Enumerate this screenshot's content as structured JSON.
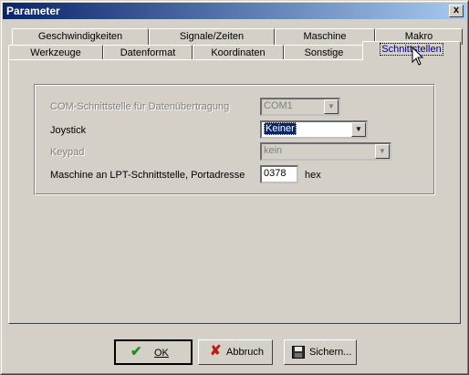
{
  "window": {
    "title": "Parameter",
    "close_label": "x"
  },
  "tabs_row_back": [
    "Geschwindigkeiten",
    "Signale/Zeiten",
    "Maschine",
    "Makro"
  ],
  "tabs_row_front": [
    "Werkzeuge",
    "Datenformat",
    "Koordinaten",
    "Sonstige",
    "Schnittstellen"
  ],
  "active_tab": "Schnittstellen",
  "form": {
    "com_label": "COM-Schnittstelle für Datenübertragung",
    "com_value": "COM1",
    "joystick_label": "Joystick",
    "joystick_value": "Keiner",
    "keypad_label": "Keypad",
    "keypad_value": "kein",
    "lpt_label": "Maschine an LPT-Schnittstelle, Portadresse",
    "lpt_value": "0378",
    "lpt_unit": "hex"
  },
  "buttons": {
    "ok": "OK",
    "cancel": "Abbruch",
    "save": "Sichern..."
  },
  "colors": {
    "titlebar_start": "#0a246a",
    "titlebar_end": "#a6caf0",
    "face": "#d4d0c8",
    "ok_check": "#1e8c1e",
    "cancel_x": "#c01818"
  },
  "icons": {
    "ok": "check-icon",
    "cancel": "x-icon",
    "save": "floppy-disk-icon"
  }
}
